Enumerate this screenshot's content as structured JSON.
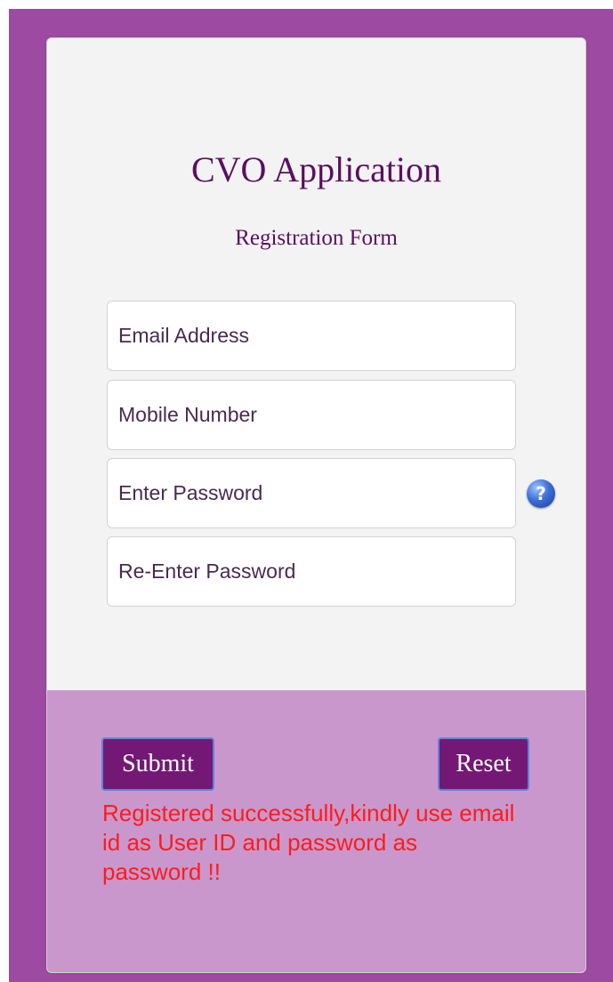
{
  "header": {
    "title": "CVO Application",
    "subtitle": "Registration Form"
  },
  "form": {
    "email_placeholder": "Email Address",
    "mobile_placeholder": "Mobile Number",
    "password_placeholder": "Enter Password",
    "reenter_password_placeholder": "Re-Enter Password",
    "help_icon": "question-circle-icon",
    "help_glyph": "?"
  },
  "actions": {
    "submit_label": "Submit",
    "reset_label": "Reset"
  },
  "status": {
    "message": "Registered successfully,kindly use email id as User ID and password as password !!"
  },
  "colors": {
    "page_background": "#9d4aa2",
    "card_background": "#f3f3f4",
    "footer_background": "#ca97cc",
    "title_color": "#5b0f5f",
    "button_background": "#741876",
    "message_color": "#ff1b1b"
  }
}
